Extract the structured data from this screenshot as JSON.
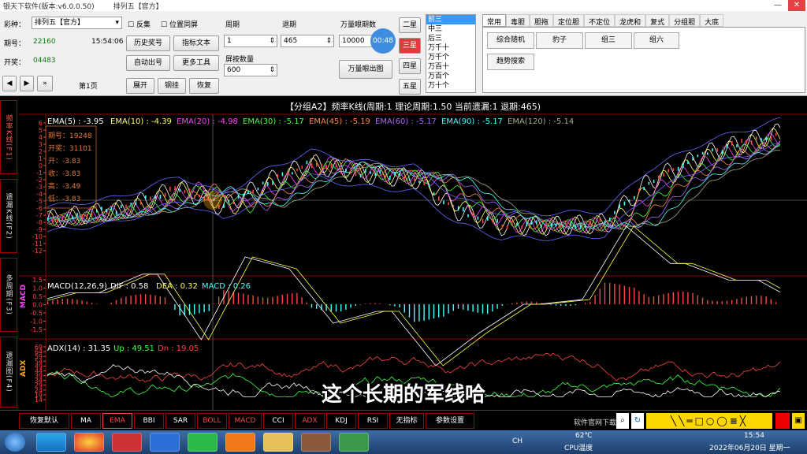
{
  "titlebar": {
    "app_title": "银天下软件(版本:v6.0.0.50)",
    "game_title": "排列五【官方】",
    "minimize": "—",
    "close": "✕"
  },
  "controls": {
    "lottery_label": "彩种：",
    "lottery_value": "排列五【官方】",
    "issue_label": "期号：",
    "issue_value": "22160",
    "time": "15:54:06",
    "draw_label": "开奖：",
    "draw_value": "04483",
    "page_label": "第1页",
    "reverse_label": "反集",
    "sync_label": "位置同屏",
    "btn_history": "历史奖号",
    "btn_indicator": "指标文本",
    "btn_auto": "自动出号",
    "btn_more": "更多工具",
    "btn_expand": "展开",
    "btn_pin": "钢挂",
    "btn_restore": "恢复",
    "period_label": "周期",
    "period_value": "1",
    "retreat_label": "退期",
    "retreat_value": "465",
    "wanliang_label": "万量眼期数",
    "wanliang_value": "10000",
    "timer": "00:48",
    "screen_label": "屏按数量",
    "screen_value": "600",
    "btn_wanliang_chart": "万量眼出图",
    "star_buttons": [
      "二星",
      "三星",
      "四星",
      "五星"
    ],
    "positions": [
      "前三",
      "中三",
      "后三",
      "万千十",
      "万千个",
      "万百十",
      "万百个",
      "万十个"
    ],
    "tabs": [
      "常用",
      "毒胆",
      "胆拖",
      "定位胆",
      "不定位",
      "龙虎和",
      "复式",
      "分组胆",
      "大底"
    ],
    "group_buttons": [
      "综合随机",
      "豹子",
      "组三",
      "组六"
    ],
    "trend_button": "趋势搜索"
  },
  "sidebar": {
    "tabs": [
      "频率K线(F1)",
      "遗漏K线(F2)",
      "多周期(F3)",
      "遗漏图(F4)"
    ]
  },
  "chart": {
    "header": "【分组A2】频率K线(周期:1 理论周期:1.50 当前遗漏:1 退期:465)",
    "ema_labels": [
      {
        "text": "EMA(5) : -3.95",
        "color": "#ffffff"
      },
      {
        "text": "EMA(10) : -4.39",
        "color": "#ffff66"
      },
      {
        "text": "EMA(20) : -4.98",
        "color": "#ff44ff"
      },
      {
        "text": "EMA(30) : -5.17",
        "color": "#44ff44"
      },
      {
        "text": "EMA(45) : -5.19",
        "color": "#ff8844"
      },
      {
        "text": "EMA(60) : -5.17",
        "color": "#aa66ff"
      },
      {
        "text": "EMA(90) : -5.17",
        "color": "#44ffff"
      },
      {
        "text": "EMA(120) : -5.14",
        "color": "#aaaa88"
      }
    ],
    "info_box": [
      "期号：19248",
      "开奖：31101",
      "开：-3.83",
      "收：-3.83",
      "高：-3.49",
      "低：-3.83"
    ],
    "y_ticks_main": [
      "6",
      "5",
      "4",
      "3",
      "2",
      "1",
      "0",
      "-1",
      "-2",
      "-3",
      "-4",
      "-5",
      "-6",
      "-7",
      "-8",
      "-9",
      "-10",
      "-11",
      "-12"
    ],
    "macd_labels": [
      {
        "text": "MACD(12,26,9)",
        "color": "#ffffff"
      },
      {
        "text": "DIF : 0.58",
        "color": "#ffffff"
      },
      {
        "text": "DEA : 0.32",
        "color": "#ffff44"
      },
      {
        "text": "MACD : 0.26",
        "color": "#44ffff"
      }
    ],
    "y_ticks_macd": [
      "1.5",
      "1.0",
      "0.5",
      "0.0",
      "-0.5",
      "-1.0",
      "-1.5"
    ],
    "adx_labels": [
      {
        "text": "ADX(14) : 31.35",
        "color": "#ffffff"
      },
      {
        "text": "Up : 49.51",
        "color": "#44ff44"
      },
      {
        "text": "Dn : 19.05",
        "color": "#ff4444"
      }
    ],
    "y_ticks_adx": [
      "69",
      "64",
      "59",
      "54",
      "49",
      "44",
      "39",
      "34",
      "29",
      "24",
      "19",
      "14"
    ],
    "axis_labels": [
      "MACD",
      "ADX"
    ],
    "subtitle": "这个长期的军线哈"
  },
  "bottombar": {
    "buttons": [
      "恢复默认",
      "MA",
      "EMA",
      "BBI",
      "SAR",
      "BOLL",
      "MACD",
      "CCI",
      "ADX",
      "KDJ",
      "RSI",
      "无指标",
      "参数设置"
    ],
    "site_text": "软件官网下载"
  },
  "taskbar": {
    "temp": "62℃",
    "cpu": "CPU温度",
    "lang": "CH",
    "time": "15:54",
    "date": "2022年06月20日 星期一"
  }
}
